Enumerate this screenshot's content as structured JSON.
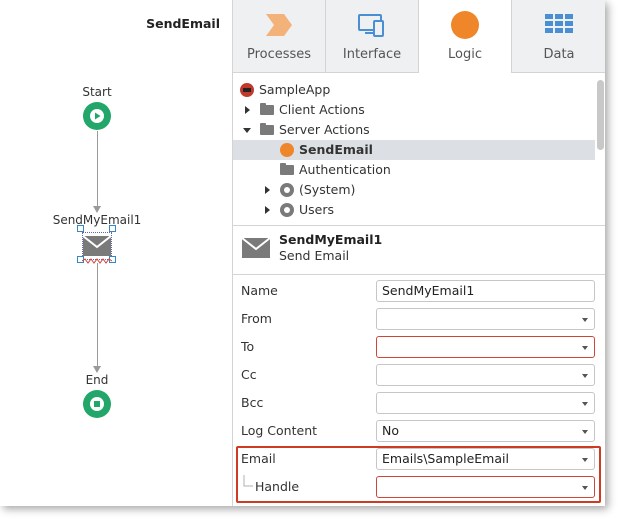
{
  "canvas": {
    "title": "SendEmail",
    "nodes": {
      "start": "Start",
      "email": "SendMyEmail1",
      "end": "End"
    }
  },
  "tabs": [
    {
      "label": "Processes",
      "icon": "processes-icon",
      "active": false
    },
    {
      "label": "Interface",
      "icon": "interface-icon",
      "active": false
    },
    {
      "label": "Logic",
      "icon": "logic-icon",
      "active": true
    },
    {
      "label": "Data",
      "icon": "data-icon",
      "active": false
    }
  ],
  "tree": {
    "root": "SampleApp",
    "items": [
      {
        "label": "Client Actions",
        "expanded": false
      },
      {
        "label": "Server Actions",
        "expanded": true
      },
      {
        "label": "SendEmail",
        "selected": true
      },
      {
        "label": "Authentication"
      },
      {
        "label": "(System)",
        "expanded": false
      },
      {
        "label": "Users",
        "expanded": false
      }
    ]
  },
  "selected_element": {
    "name": "SendMyEmail1",
    "type": "Send Email"
  },
  "properties": [
    {
      "label": "Name",
      "value": "SendMyEmail1",
      "dropdown": false,
      "error": false
    },
    {
      "label": "From",
      "value": "",
      "dropdown": true,
      "error": false
    },
    {
      "label": "To",
      "value": "",
      "dropdown": true,
      "error": true
    },
    {
      "label": "Cc",
      "value": "",
      "dropdown": true,
      "error": false
    },
    {
      "label": "Bcc",
      "value": "",
      "dropdown": true,
      "error": false
    },
    {
      "label": "Log Content",
      "value": "No",
      "dropdown": true,
      "error": false
    },
    {
      "label": "Email",
      "value": "Emails\\SampleEmail",
      "dropdown": true,
      "error": false
    },
    {
      "label": "Handle",
      "value": "",
      "dropdown": true,
      "error": true
    }
  ],
  "colors": {
    "accent_orange": "#f0862a",
    "flow_green": "#23a66a",
    "error_red": "#d0453a",
    "highlight_red": "#cf3a22",
    "tab_blue": "#4a8fd4"
  }
}
